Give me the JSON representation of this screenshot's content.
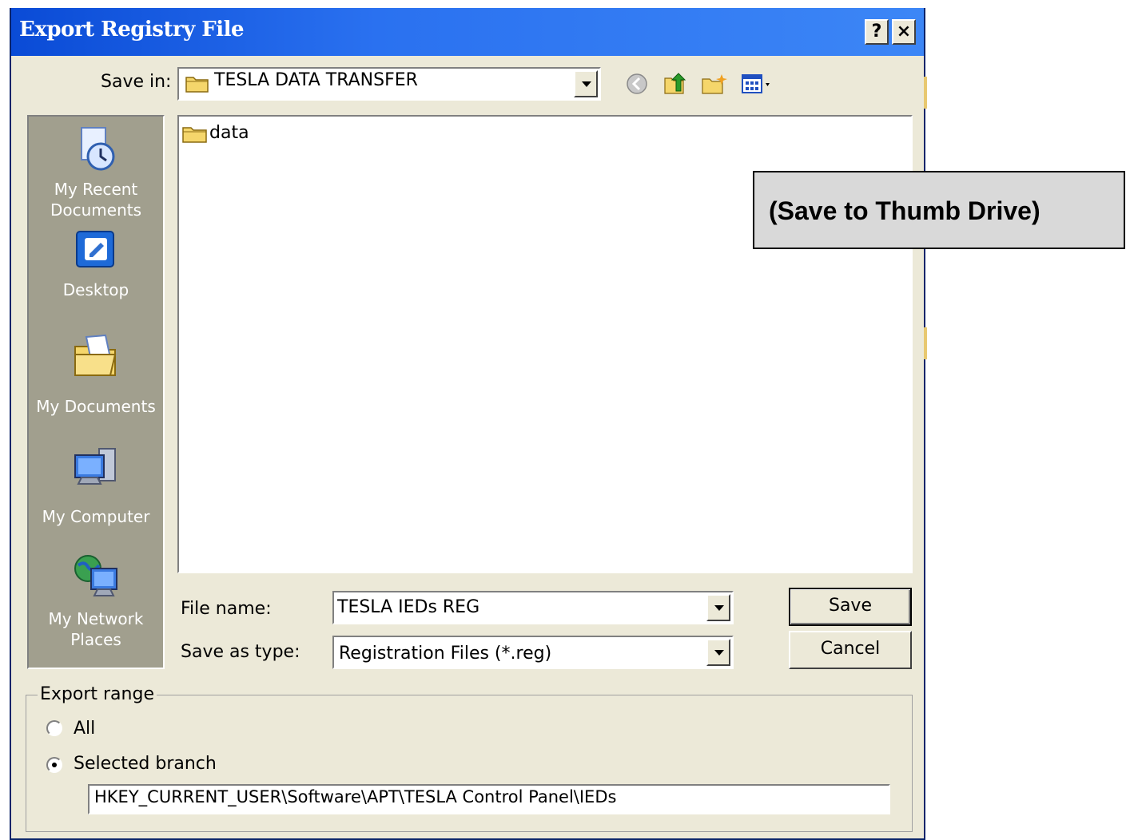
{
  "window": {
    "title": "Export Registry File",
    "help_label": "?",
    "close_label": "×"
  },
  "toolbar": {
    "save_in_label": "Save in:",
    "save_in_value": "TESLA DATA TRANSFER"
  },
  "places_bar": [
    {
      "label": "My Recent Documents"
    },
    {
      "label": "Desktop"
    },
    {
      "label": "My Documents"
    },
    {
      "label": "My Computer"
    },
    {
      "label": "My Network Places"
    }
  ],
  "file_list": {
    "items": [
      {
        "name": "data",
        "type": "folder"
      }
    ]
  },
  "form": {
    "file_name_label": "File name:",
    "file_name_value": "TESLA IEDs REG",
    "save_as_type_label": "Save as type:",
    "save_as_type_value": "Registration Files (*.reg)",
    "save_button": "Save",
    "cancel_button": "Cancel"
  },
  "export_range": {
    "label": "Export range",
    "option_all": "All",
    "option_selected": "Selected branch",
    "selected": "Selected branch",
    "branch_path": "HKEY_CURRENT_USER\\Software\\APT\\TESLA Control Panel\\IEDs"
  },
  "annotation": {
    "text": "(Save to Thumb Drive)"
  },
  "colors": {
    "titlebar": "#0a4bd6",
    "dialog_bg": "#ece9d8",
    "places_bg": "#a19f8e",
    "callout_bg": "#d9d9d9"
  }
}
